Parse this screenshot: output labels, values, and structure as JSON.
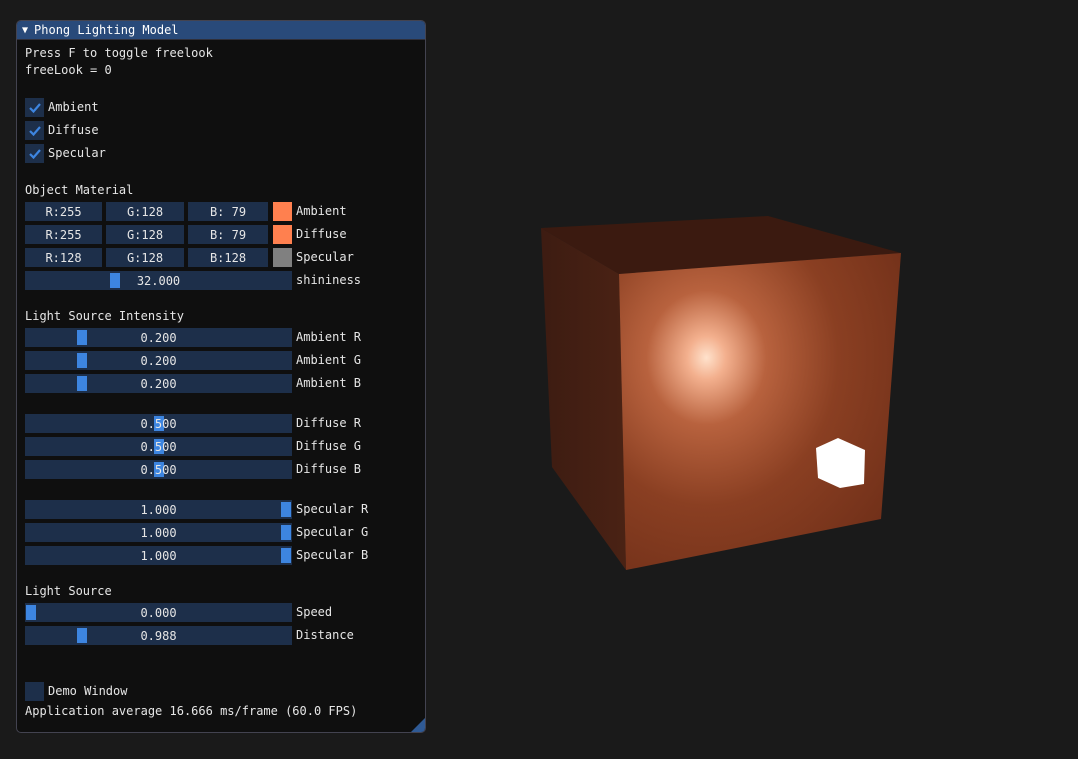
{
  "window": {
    "title": "Phong Lighting Model",
    "help_text": "Press F to toggle freelook",
    "freelook_text": "freeLook = 0",
    "checkboxes": [
      {
        "label": "Ambient",
        "checked": true
      },
      {
        "label": "Diffuse",
        "checked": true
      },
      {
        "label": "Specular",
        "checked": true
      }
    ],
    "material": {
      "header": "Object Material",
      "rows": [
        {
          "r": "R:255",
          "g": "G:128",
          "b": "B: 79",
          "color": "#ff804f",
          "label": "Ambient"
        },
        {
          "r": "R:255",
          "g": "G:128",
          "b": "B: 79",
          "color": "#ff804f",
          "label": "Diffuse"
        },
        {
          "r": "R:128",
          "g": "G:128",
          "b": "B:128",
          "color": "#808080",
          "label": "Specular"
        }
      ],
      "shininess": {
        "value": "32.000",
        "label": "shininess",
        "level": 0.33
      }
    },
    "intensity": {
      "header": "Light Source Intensity",
      "sliders": [
        {
          "value": "0.200",
          "label": "Ambient R",
          "level": 0.2
        },
        {
          "value": "0.200",
          "label": "Ambient G",
          "level": 0.2
        },
        {
          "value": "0.200",
          "label": "Ambient B",
          "level": 0.2
        },
        {
          "value": "0.500",
          "label": "Diffuse R",
          "level": 0.5
        },
        {
          "value": "0.500",
          "label": "Diffuse G",
          "level": 0.5
        },
        {
          "value": "0.500",
          "label": "Diffuse B",
          "level": 0.5
        },
        {
          "value": "1.000",
          "label": "Specular R",
          "level": 1.0
        },
        {
          "value": "1.000",
          "label": "Specular G",
          "level": 1.0
        },
        {
          "value": "1.000",
          "label": "Specular B",
          "level": 1.0
        }
      ]
    },
    "light_source": {
      "header": "Light Source",
      "sliders": [
        {
          "value": "0.000",
          "label": "Speed",
          "level": 0.0
        },
        {
          "value": "0.988",
          "label": "Distance",
          "level": 0.2
        }
      ]
    },
    "demo_window": {
      "label": "Demo Window",
      "checked": false
    },
    "fps_text": "Application average 16.666 ms/frame (60.0 FPS)"
  },
  "colors": {
    "accent": "#3d85e0",
    "frame_bg": "#1d2f4a",
    "title_bg": "#294a7a"
  }
}
